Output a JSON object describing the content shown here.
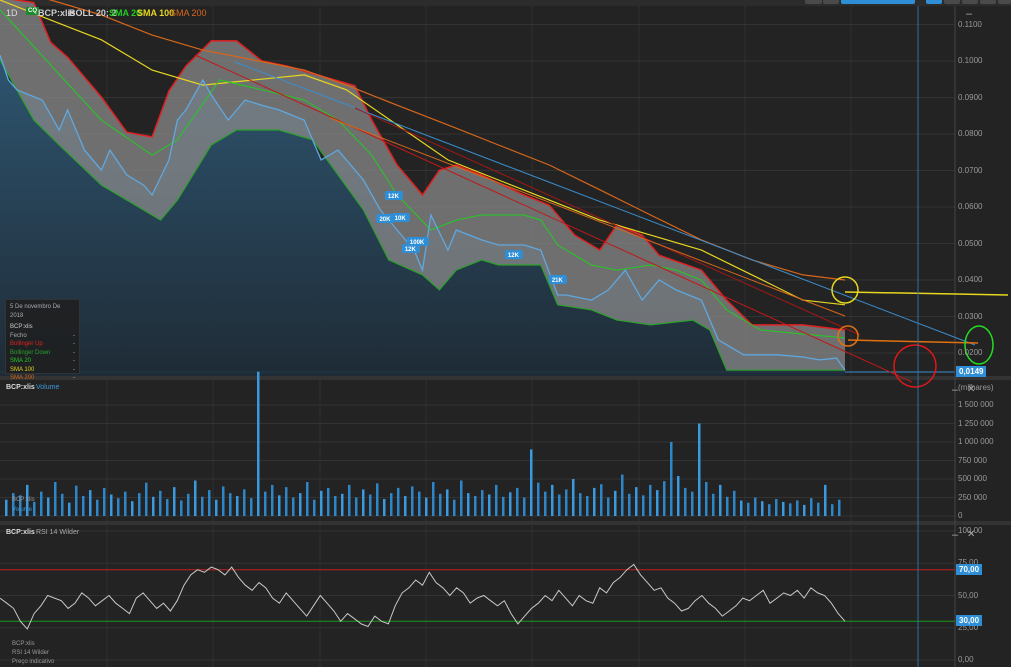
{
  "header": {
    "period": "1D",
    "symbol": "BCP:xlis",
    "boll": "BOLL 20; 2",
    "sma20": "SMA 20",
    "sma100": "SMA 100",
    "sma200": "SMA 200",
    "badge": "CQ"
  },
  "legend_box": {
    "date": "5 De novembro De 2018",
    "symbol": "BCP:xlis",
    "rows": [
      {
        "label": "Fecho",
        "value": "-"
      },
      {
        "label": "Bollinger Up",
        "value": "-"
      },
      {
        "label": "Bollinger Down",
        "value": "-"
      },
      {
        "label": "SMA 20",
        "value": "-"
      },
      {
        "label": "SMA 100",
        "value": "-"
      },
      {
        "label": "SMA 200",
        "value": "-"
      }
    ]
  },
  "volume_panel": {
    "symbol": "BCP:xlis",
    "title": "Volume",
    "unit": "(milhares)",
    "legend_symbol": "BCP:xlis",
    "legend_title": "Volume"
  },
  "rsi_panel": {
    "symbol": "BCP:xlis",
    "title": "RSI 14 Wilder",
    "legend_symbol": "BCP:xlis",
    "legend_title": "RSI 14 Wilder",
    "legend_note": "Preço indicativo",
    "tag70": "70,00",
    "tag30": "30,00"
  },
  "controls": {
    "minimize": "–",
    "close": "✕"
  },
  "colors": {
    "close": "#5fa8e0",
    "upper": "#e02020",
    "lower": "#2aa02a",
    "sma20": "#22cc22",
    "sma100": "#e6d620",
    "sma200": "#d8661a",
    "accent": "#2e8fd6"
  },
  "chart_data": [
    {
      "type": "line",
      "title": "BCP:xlis 1D",
      "ylim": [
        0.0149,
        0.112
      ],
      "y_ticks": [
        "0.1100",
        "0.1000",
        "0.0900",
        "0.0800",
        "0.0700",
        "0.0600",
        "0.0500",
        "0.0400",
        "0.0300",
        "0.0200"
      ],
      "y_tick_values": [
        0.11,
        0.1,
        0.09,
        0.08,
        0.07,
        0.06,
        0.05,
        0.04,
        0.03,
        0.02
      ],
      "last_price_label": "0,0149",
      "last_price": 0.0149,
      "annotations": [
        {
          "text": "12K",
          "t": 46.5,
          "p": 0.063
        },
        {
          "text": "20K",
          "t": 45.5,
          "p": 0.0567
        },
        {
          "text": "10K",
          "t": 47.3,
          "p": 0.057
        },
        {
          "text": "100K",
          "t": 49.1,
          "p": 0.0504
        },
        {
          "text": "12K",
          "t": 48.5,
          "p": 0.0485
        },
        {
          "text": "12K",
          "t": 60.7,
          "p": 0.0468
        },
        {
          "text": "21K",
          "t": 65.9,
          "p": 0.04
        }
      ],
      "series": [
        {
          "name": "Fecho",
          "t": [
            0,
            1,
            2,
            5,
            7,
            8,
            10,
            12,
            13,
            15,
            17,
            18,
            20,
            21,
            22,
            24,
            25,
            27,
            29,
            31,
            33,
            36,
            38,
            40,
            43,
            45,
            47,
            49,
            50,
            51,
            53,
            54,
            57,
            59,
            62,
            64,
            66,
            67,
            70,
            72,
            74,
            76,
            78,
            80,
            83,
            85,
            88,
            90,
            92,
            95,
            97,
            99,
            100
          ],
          "p": [
            0.1016,
            0.0948,
            0.0921,
            0.0893,
            0.0811,
            0.0866,
            0.0756,
            0.0701,
            0.0756,
            0.0688,
            0.066,
            0.0633,
            0.0729,
            0.0838,
            0.0866,
            0.0948,
            0.0907,
            0.0838,
            0.0893,
            0.0879,
            0.0866,
            0.0838,
            0.0729,
            0.0756,
            0.0674,
            0.0592,
            0.0537,
            0.0482,
            0.0427,
            0.0578,
            0.0482,
            0.0537,
            0.051,
            0.0496,
            0.0496,
            0.0482,
            0.0359,
            0.0359,
            0.0345,
            0.0373,
            0.0427,
            0.0345,
            0.04,
            0.0373,
            0.0345,
            0.0236,
            0.0195,
            0.0195,
            0.0195,
            0.0189,
            0.0181,
            0.0186,
            0.0153
          ]
        },
        {
          "name": "Bollinger Up",
          "t": [
            0,
            4,
            6,
            8,
            12,
            15,
            18,
            20,
            22,
            25,
            28,
            31,
            34,
            38,
            42,
            44,
            47,
            50,
            52,
            54,
            57,
            62,
            65,
            68,
            71,
            73,
            76,
            78,
            83,
            86,
            89,
            95,
            100
          ],
          "p": [
            0.1174,
            0.116,
            0.1051,
            0.101,
            0.0901,
            0.0805,
            0.0792,
            0.0918,
            0.0986,
            0.1055,
            0.1055,
            0.1,
            0.0986,
            0.0959,
            0.0932,
            0.0838,
            0.0715,
            0.0633,
            0.0701,
            0.0715,
            0.0688,
            0.0633,
            0.0605,
            0.0523,
            0.0482,
            0.0551,
            0.0523,
            0.0468,
            0.0427,
            0.0345,
            0.0277,
            0.0277,
            0.0263
          ]
        },
        {
          "name": "Bollinger Down",
          "t": [
            0,
            4,
            7,
            12,
            15,
            19,
            21,
            25,
            28,
            33,
            37,
            40,
            43,
            46,
            50,
            52,
            54,
            57,
            59,
            64,
            66,
            70,
            73,
            77,
            82,
            84,
            86,
            90,
            100
          ],
          "p": [
            0.1003,
            0.0838,
            0.077,
            0.066,
            0.0619,
            0.0564,
            0.0619,
            0.077,
            0.0811,
            0.0811,
            0.0784,
            0.0688,
            0.0592,
            0.0455,
            0.0414,
            0.0373,
            0.0427,
            0.0455,
            0.0441,
            0.0441,
            0.0332,
            0.0318,
            0.029,
            0.0277,
            0.029,
            0.0263,
            0.0153,
            0.0153,
            0.0153
          ]
        },
        {
          "name": "SMA 20",
          "t": [
            0,
            6,
            12,
            18,
            21,
            26,
            31,
            36,
            40,
            44,
            47,
            51,
            54,
            57,
            62,
            64,
            66,
            70,
            73,
            77,
            80,
            83,
            86,
            90,
            100
          ],
          "p": [
            0.114,
            0.0989,
            0.0838,
            0.0742,
            0.0784,
            0.0948,
            0.0921,
            0.0893,
            0.0838,
            0.0742,
            0.0633,
            0.0537,
            0.0564,
            0.0578,
            0.0578,
            0.0564,
            0.0496,
            0.0441,
            0.0427,
            0.0441,
            0.0427,
            0.04,
            0.0318,
            0.0263,
            0.0241
          ]
        },
        {
          "name": "SMA 100",
          "t": [
            0,
            6,
            12,
            18,
            24,
            30,
            36,
            41,
            47,
            53,
            59,
            65,
            71,
            77,
            83,
            89,
            95,
            100
          ],
          "p": [
            0.1167,
            0.1112,
            0.1058,
            0.0975,
            0.0934,
            0.0948,
            0.0962,
            0.0921,
            0.0825,
            0.0729,
            0.0674,
            0.0619,
            0.0564,
            0.0523,
            0.0482,
            0.0414,
            0.0345,
            0.0332
          ]
        },
        {
          "name": "SMA 200",
          "t": [
            0,
            6,
            12,
            18,
            24,
            30,
            36,
            41,
            47,
            53,
            59,
            65,
            71,
            77,
            83,
            89,
            95,
            100
          ],
          "p": [
            0.1208,
            0.1167,
            0.1126,
            0.1071,
            0.103,
            0.1003,
            0.0975,
            0.0934,
            0.0879,
            0.0825,
            0.077,
            0.0715,
            0.0647,
            0.0578,
            0.051,
            0.0455,
            0.0414,
            0.04
          ]
        }
      ]
    },
    {
      "type": "bar",
      "title": "Volume",
      "ylabel": "(milhares)",
      "ylim": [
        0,
        1700000
      ],
      "y_ticks": [
        "1 500 000",
        "1 250 000",
        "1 000 000",
        "750 000",
        "500 000",
        "250 000",
        "0"
      ],
      "y_tick_values": [
        1500000,
        1250000,
        1000000,
        750000,
        500000,
        250000,
        0
      ],
      "values_thousands": [
        220,
        310,
        280,
        420,
        190,
        330,
        250,
        460,
        300,
        180,
        410,
        270,
        350,
        220,
        380,
        290,
        240,
        330,
        200,
        310,
        450,
        260,
        340,
        230,
        390,
        210,
        300,
        480,
        260,
        350,
        220,
        400,
        310,
        270,
        360,
        240,
        1950,
        330,
        420,
        280,
        390,
        250,
        310,
        460,
        220,
        340,
        380,
        270,
        300,
        420,
        250,
        360,
        290,
        440,
        230,
        310,
        380,
        270,
        400,
        330,
        250,
        460,
        300,
        360,
        220,
        480,
        310,
        270,
        350,
        290,
        420,
        260,
        320,
        380,
        250,
        900,
        450,
        330,
        420,
        290,
        360,
        500,
        310,
        270,
        380,
        430,
        250,
        340,
        560,
        300,
        390,
        280,
        420,
        350,
        470,
        1000,
        540,
        380,
        330,
        1250,
        460,
        300,
        420,
        260,
        340,
        210,
        180,
        250,
        200,
        160,
        230,
        190,
        170,
        210,
        150,
        240,
        180,
        420,
        160,
        220
      ]
    },
    {
      "type": "line",
      "title": "RSI 14 Wilder",
      "ylim": [
        0,
        100
      ],
      "y_ticks": [
        "100,00",
        "75,00",
        "50,00",
        "25,00",
        "0,00"
      ],
      "y_tick_values": [
        100,
        75,
        50,
        25,
        0
      ],
      "levels": [
        70,
        30
      ],
      "values": [
        48,
        44,
        40,
        30,
        24,
        36,
        42,
        50,
        48,
        46,
        40,
        44,
        52,
        48,
        42,
        46,
        50,
        44,
        40,
        36,
        48,
        52,
        46,
        40,
        44,
        38,
        46,
        58,
        66,
        70,
        68,
        72,
        70,
        66,
        72,
        64,
        58,
        54,
        60,
        56,
        48,
        44,
        52,
        46,
        40,
        34,
        42,
        50,
        44,
        38,
        30,
        36,
        32,
        28,
        26,
        34,
        30,
        28,
        42,
        52,
        56,
        62,
        58,
        68,
        60,
        56,
        50,
        56,
        52,
        44,
        48,
        50,
        46,
        42,
        46,
        36,
        28,
        34,
        40,
        44,
        50,
        46,
        54,
        48,
        42,
        50,
        46,
        44,
        56,
        52,
        60,
        64,
        70,
        74,
        66,
        60,
        54,
        56,
        48,
        44,
        38,
        40,
        46,
        50,
        44,
        40,
        34,
        38,
        42,
        48,
        46,
        50,
        54,
        44,
        48,
        52,
        50,
        54,
        48,
        56,
        52,
        50,
        44,
        36,
        30
      ]
    }
  ]
}
